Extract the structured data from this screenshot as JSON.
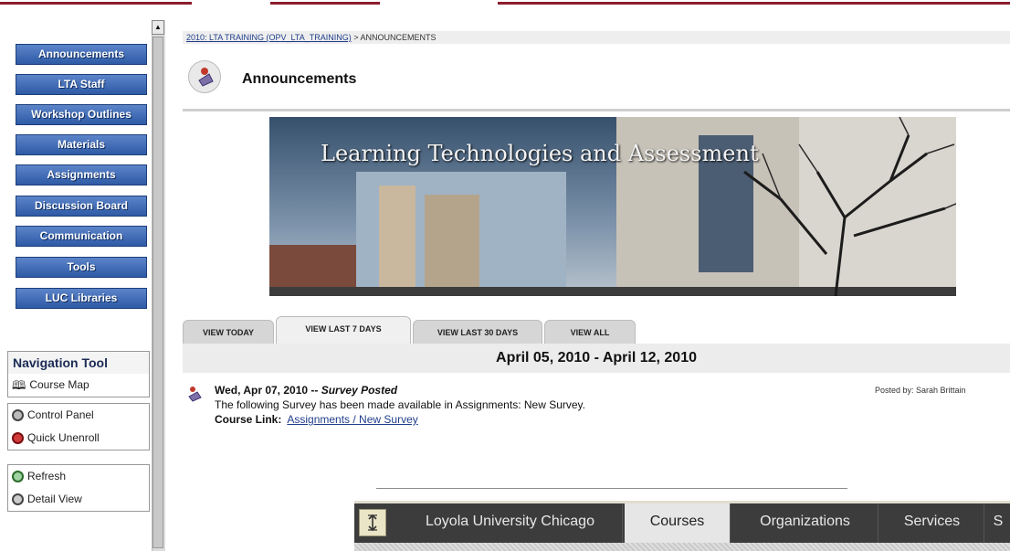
{
  "sidebar": {
    "menu": [
      {
        "label": "Announcements"
      },
      {
        "label": "LTA Staff"
      },
      {
        "label": "Workshop Outlines"
      },
      {
        "label": "Materials"
      },
      {
        "label": "Assignments"
      },
      {
        "label": "Discussion Board"
      },
      {
        "label": "Communication"
      },
      {
        "label": "Tools"
      },
      {
        "label": "LUC Libraries"
      }
    ],
    "nav_tool_header": "Navigation Tool",
    "course_map": "Course Map",
    "control_panel": "Control Panel",
    "quick_unenroll": "Quick Unenroll",
    "refresh": "Refresh",
    "detail_view": "Detail View"
  },
  "breadcrumb": {
    "course_link": "2010: LTA TRAINING (OPV_LTA_TRAINING)",
    "current": " > ANNOUNCEMENTS"
  },
  "page": {
    "title": "Announcements",
    "banner_text": "Learning Technologies and Assessment"
  },
  "tabs": [
    {
      "label": "VIEW TODAY"
    },
    {
      "label": "VIEW LAST 7 DAYS"
    },
    {
      "label": "VIEW LAST 30 DAYS"
    },
    {
      "label": "VIEW ALL"
    }
  ],
  "date_range": "April 05, 2010 - April 12, 2010",
  "announcement": {
    "date": "Wed, Apr 07, 2010 -- ",
    "subject": "Survey Posted",
    "posted_by": "Posted by: Sarah Brittain",
    "body": "The following Survey has been made available in Assignments: New Survey.",
    "course_link_label": "Course Link:",
    "course_link": "Assignments / New Survey"
  },
  "bottom_tabs": [
    {
      "label": "Loyola University Chicago"
    },
    {
      "label": "Courses"
    },
    {
      "label": "Organizations"
    },
    {
      "label": "Services"
    },
    {
      "label": "S"
    }
  ],
  "colors": {
    "accent_maroon": "#8c1d2f",
    "menu_blue": "#2f5aa5",
    "link_blue": "#1f3d8a"
  }
}
